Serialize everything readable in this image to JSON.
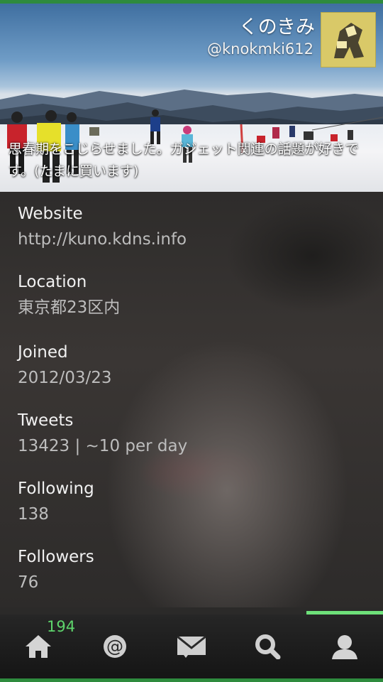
{
  "header": {
    "name": "くのきみ",
    "handle": "@knokmki612",
    "bio": "思春期をこじらせました。ガジェット関連の話題が好きです。(たまに買います)"
  },
  "info": [
    {
      "label": "Website",
      "value": "http://kuno.kdns.info"
    },
    {
      "label": "Location",
      "value": "東京都23区内"
    },
    {
      "label": "Joined",
      "value": "2012/03/23"
    },
    {
      "label": "Tweets",
      "value": "13423 | ~10 per day"
    },
    {
      "label": "Following",
      "value": "138"
    },
    {
      "label": "Followers",
      "value": "76"
    }
  ],
  "tabbar": {
    "home_badge": "194",
    "tabs": [
      "home-icon",
      "at-sign-icon",
      "mail-icon",
      "search-icon",
      "user-icon"
    ],
    "active_tab": "user-icon"
  },
  "colors": {
    "accent_green": "#2e8b3e",
    "active_indicator": "#6ee07a",
    "badge_green": "#5ed46c"
  }
}
